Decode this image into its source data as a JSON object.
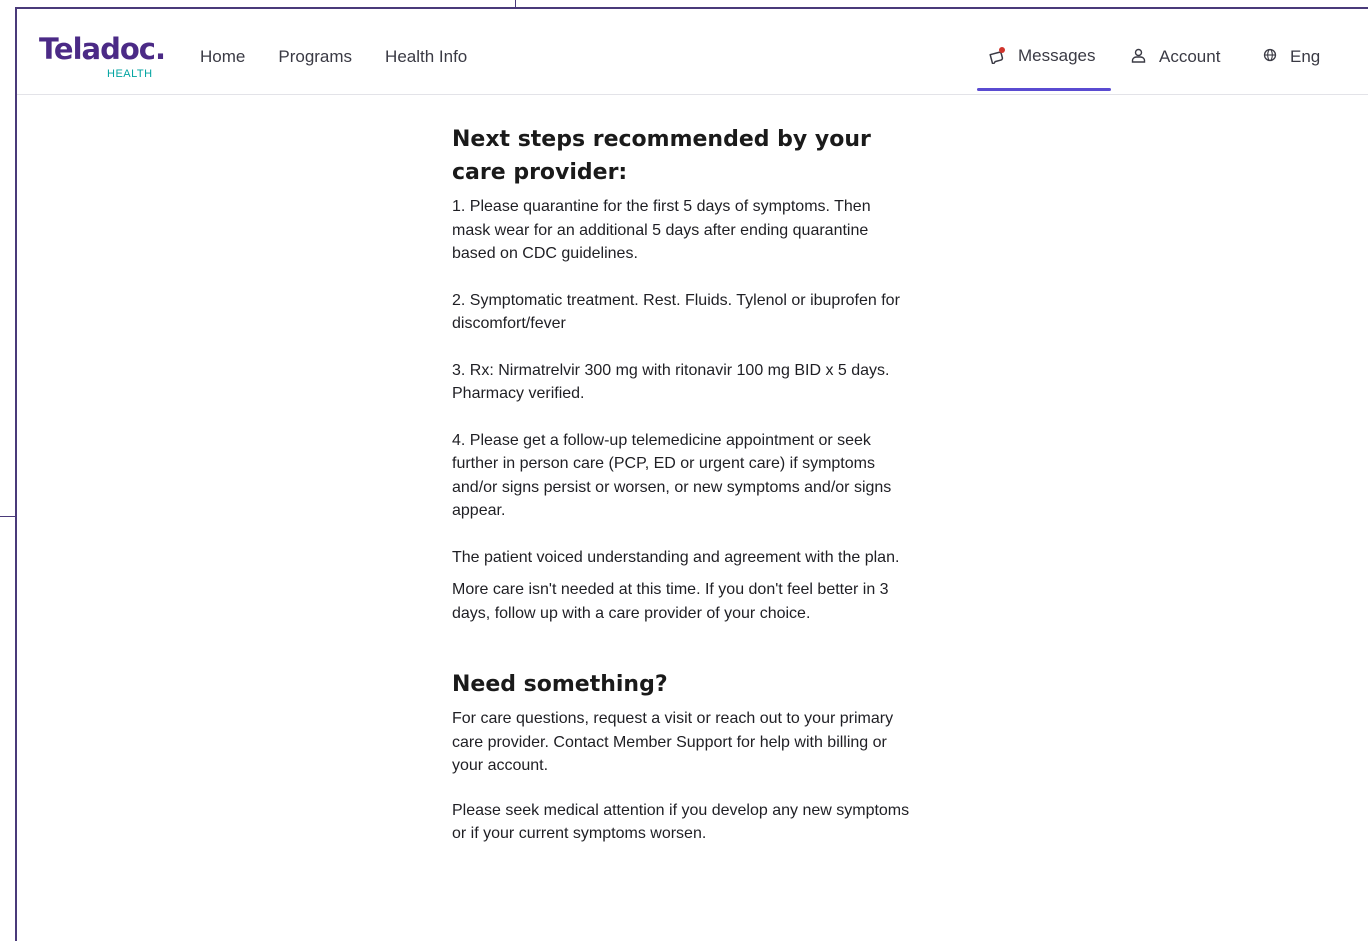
{
  "header": {
    "logo": {
      "word": "Teladoc.",
      "sub": "HEALTH"
    },
    "nav_left": [
      "Home",
      "Programs",
      "Health Info"
    ],
    "nav_right": {
      "messages": {
        "label": "Messages",
        "icon": "message-notification-icon",
        "active": true
      },
      "account": {
        "label": "Account",
        "icon": "user-icon"
      },
      "language": {
        "label": "Eng",
        "icon": "globe-icon"
      }
    },
    "accent_color": "#5a4bd1"
  },
  "next_steps": {
    "title": "Next steps recommended by your care provider:",
    "items": [
      "1. Please quarantine for the first 5 days of symptoms. Then mask wear for an additional 5 days after ending quarantine based on CDC guidelines.",
      "2. Symptomatic treatment. Rest. Fluids. Tylenol or ibuprofen for discomfort/fever",
      "3. Rx: Nirmatrelvir 300 mg with ritonavir 100 mg BID x 5 days. Pharmacy verified.",
      "4. Please get a follow-up telemedicine appointment or seek further in person care (PCP, ED or urgent care) if symptoms and/or signs persist or worsen, or new symptoms and/or signs appear."
    ],
    "patient_note": "The patient voiced understanding and agreement with the plan.",
    "more_care": "More care isn't needed at this time. If you don't feel better in 3 days, follow up with a care provider of your choice."
  },
  "need_something": {
    "title": "Need something?",
    "p1": "For care questions, request a visit or reach out to your primary care provider. Contact Member Support for help with billing or your account.",
    "p2": "Please seek medical attention if you develop any new symptoms or if your current symptoms worsen."
  }
}
